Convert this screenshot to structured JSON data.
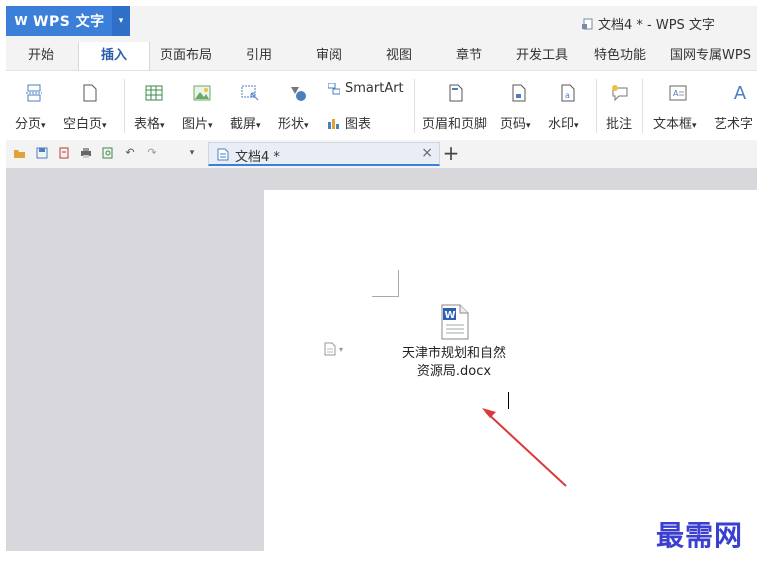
{
  "app": {
    "name": "WPS 文字",
    "logo": "W",
    "window_title": "文档4 * - WPS 文字"
  },
  "menu": [
    {
      "label": "开始"
    },
    {
      "label": "插入"
    },
    {
      "label": "页面布局"
    },
    {
      "label": "引用"
    },
    {
      "label": "审阅"
    },
    {
      "label": "视图"
    },
    {
      "label": "章节"
    },
    {
      "label": "开发工具"
    },
    {
      "label": "特色功能"
    },
    {
      "label": "国网专属WPS"
    }
  ],
  "ribbon": {
    "page_break": "分页",
    "blank_page": "空白页",
    "table": "表格",
    "picture": "图片",
    "screenshot": "截屏",
    "shape": "形状",
    "smartart": "SmartArt",
    "chart": "图表",
    "header_footer": "页眉和页脚",
    "page_number": "页码",
    "watermark": "水印",
    "comment": "批注",
    "textbox": "文本框",
    "wordart": "艺术字",
    "dropdown_glyph": "▾"
  },
  "tabs": {
    "doc_tab": "文档4 *",
    "close": "×",
    "new": "+"
  },
  "document": {
    "file_name_line1": "天津市规划和自然",
    "file_name_line2": "资源局.docx"
  },
  "watermark": "最需网",
  "colors": {
    "accent": "#3b7fd9",
    "arrow": "#d93a3a",
    "watermark": "#3a3fcf"
  }
}
